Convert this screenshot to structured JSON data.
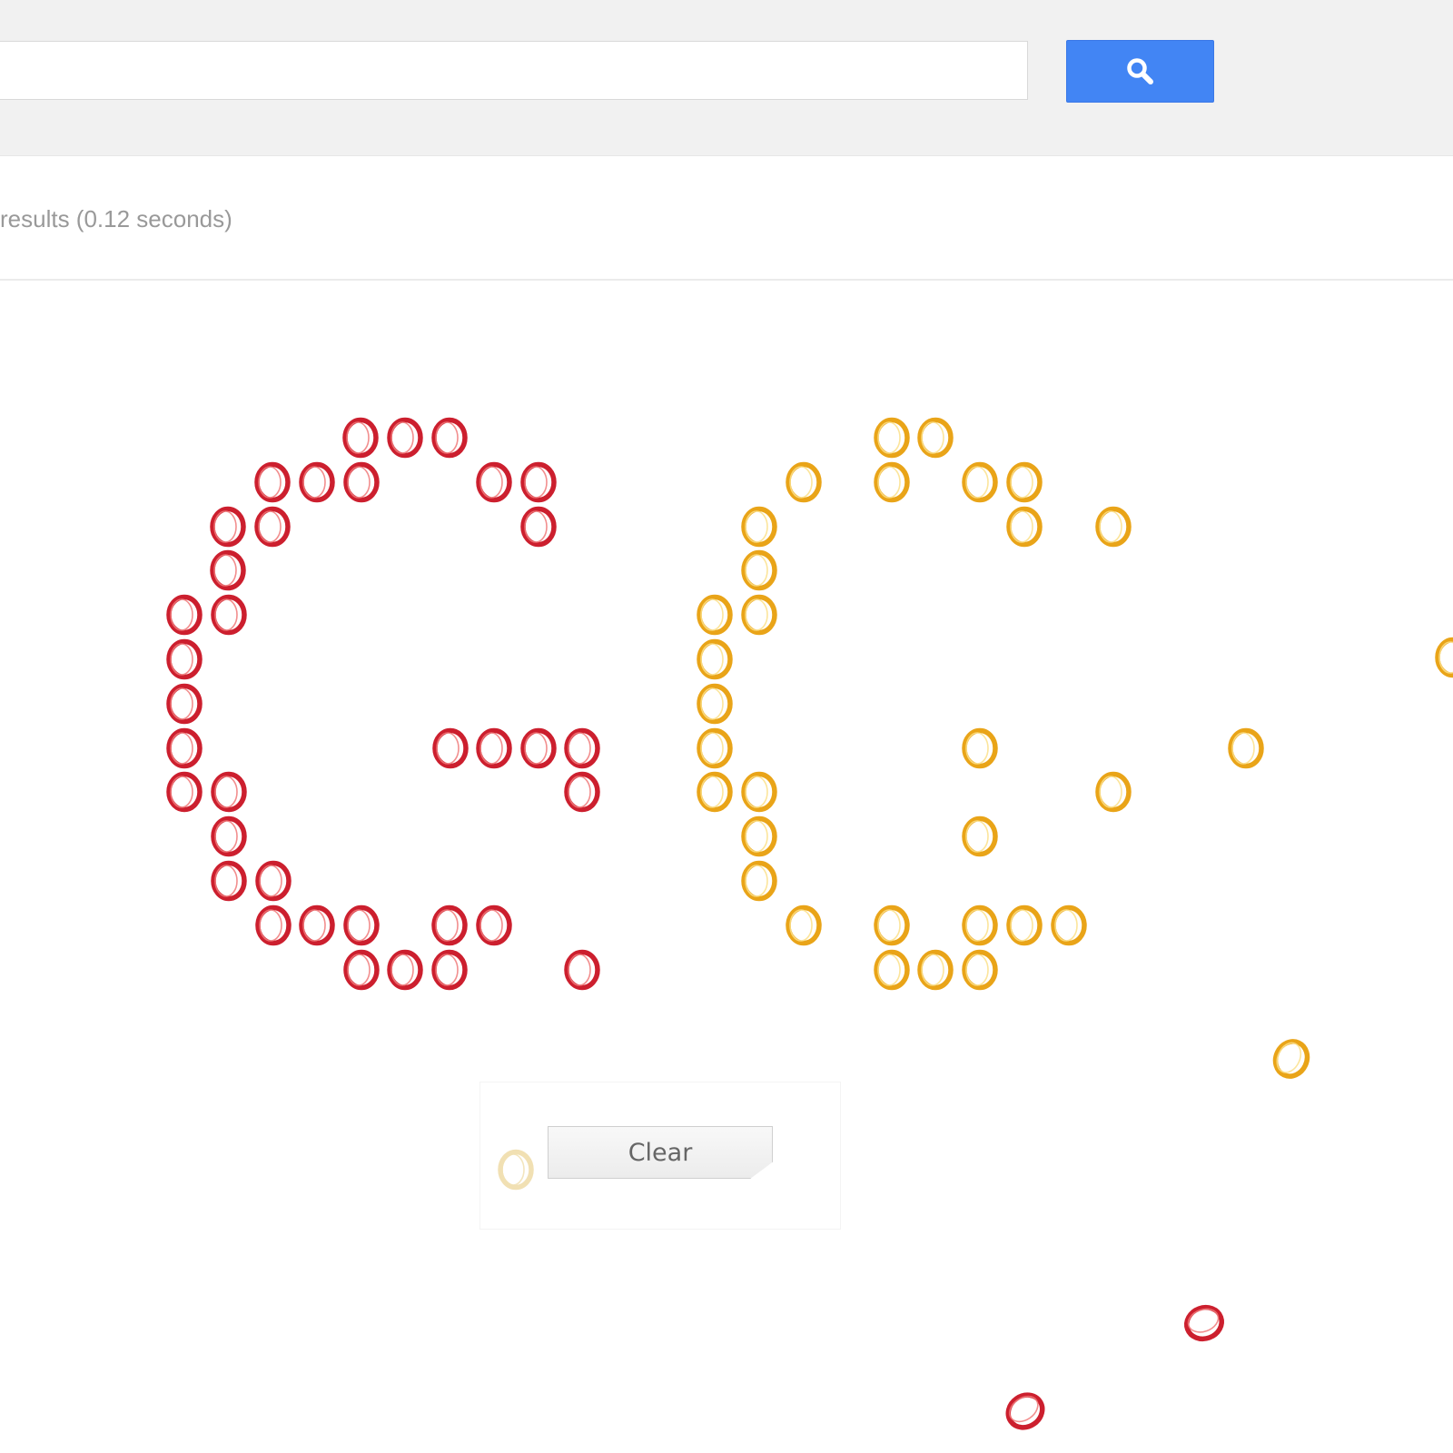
{
  "search": {
    "value": "",
    "placeholder": "",
    "button_icon": "search-icon",
    "button_color": "#4285f4"
  },
  "results": {
    "stats_text": "results (0.12 seconds)"
  },
  "doodle": {
    "letter_glyph": "O",
    "colors": {
      "red": "#cc1f2e",
      "red_highlight": "#f07a7a",
      "yellow": "#e9a418",
      "yellow_highlight": "#fbe08a",
      "faded": "#f1e0b3"
    },
    "clear_label": "Clear"
  }
}
